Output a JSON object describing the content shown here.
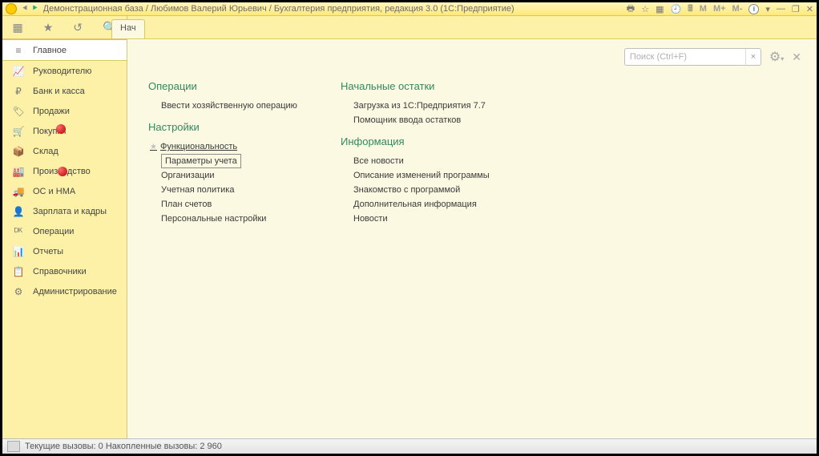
{
  "window": {
    "title": "Демонстрационная база / Любимов Валерий Юрьевич / Бухгалтерия предприятия, редакция 3.0  (1С:Предприятие)",
    "top_buttons": {
      "m1": "M",
      "m2": "M+",
      "m3": "M-"
    }
  },
  "tab": {
    "label": "Нач"
  },
  "search": {
    "placeholder": "Поиск (Ctrl+F)",
    "clear": "×"
  },
  "sidebar": {
    "items": [
      {
        "icon": "≡",
        "label": "Главное",
        "selected": true
      },
      {
        "icon": "📈",
        "label": "Руководителю"
      },
      {
        "icon": "₽",
        "label": "Банк и касса"
      },
      {
        "icon": "🏷",
        "label": "Продажи"
      },
      {
        "icon": "🛒",
        "label": "Покупки"
      },
      {
        "icon": "📦",
        "label": "Склад"
      },
      {
        "icon": "🏭",
        "label": "Производство"
      },
      {
        "icon": "🚚",
        "label": "ОС и НМА"
      },
      {
        "icon": "👤",
        "label": "Зарплата и кадры"
      },
      {
        "icon": "ᴰᴷ",
        "label": "Операции"
      },
      {
        "icon": "📊",
        "label": "Отчеты"
      },
      {
        "icon": "📋",
        "label": "Справочники"
      },
      {
        "icon": "⚙",
        "label": "Администрирование"
      }
    ]
  },
  "panel": {
    "col1": {
      "g1_title": "Операции",
      "g1_items": [
        "Ввести хозяйственную операцию"
      ],
      "g2_title": "Настройки",
      "g2_items": [
        "Функциональность",
        "Параметры учета",
        "Организации",
        "Учетная политика",
        "План счетов",
        "Персональные настройки"
      ]
    },
    "col2": {
      "g1_title": "Начальные остатки",
      "g1_items": [
        "Загрузка из 1С:Предприятия 7.7",
        "Помощник ввода остатков"
      ],
      "g2_title": "Информация",
      "g2_items": [
        "Все новости",
        "Описание изменений программы",
        "Знакомство с программой",
        "Дополнительная информация",
        "Новости"
      ]
    }
  },
  "statusbar": {
    "text": "Текущие вызовы: 0  Накопленные вызовы: 2 960"
  }
}
